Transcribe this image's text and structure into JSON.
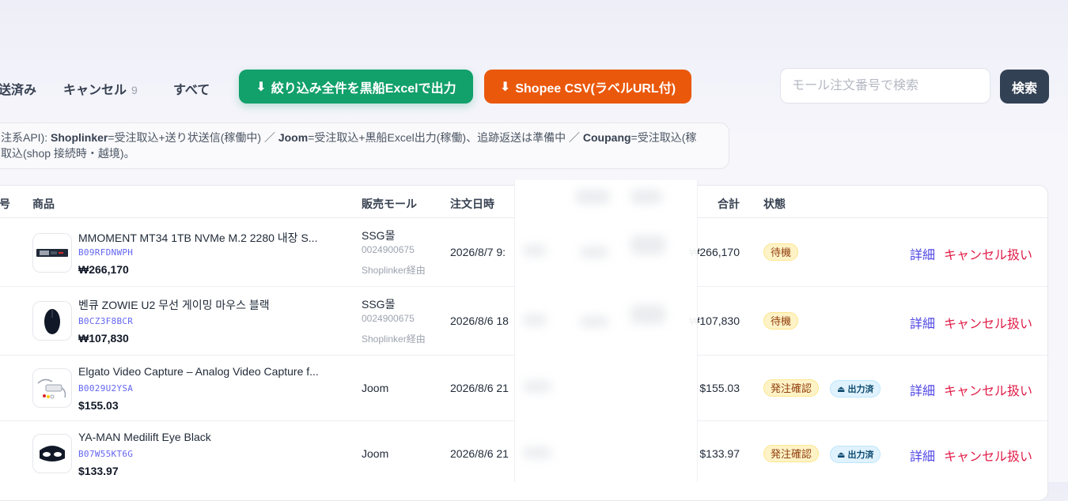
{
  "tabs": [
    {
      "label": "送済み",
      "count": ""
    },
    {
      "label": "キャンセル",
      "count": "9"
    },
    {
      "label": "すべて",
      "count": ""
    }
  ],
  "toolbar": {
    "excel_label": "絞り込み全件を黒船Excelで出力",
    "shopee_label": "Shopee CSV(ラベルURL付)",
    "download_glyph": "⬇",
    "search_placeholder": "モール注文番号で検索",
    "search_button": "検索"
  },
  "info": {
    "prefix": "注系API): ",
    "shoplinker": "Shoplinker",
    "shoplinker_desc": "=受注取込+送り状送信(稼働中) ／ ",
    "joom": "Joom",
    "joom_desc": "=受注取込+黒船Excel出力(稼働)、追跡返送は準備中 ／ ",
    "coupang": "Coupang",
    "coupang_desc": "=受注取込(稼",
    "line2": "取込(shop 接続時・越境)。"
  },
  "table": {
    "headers": {
      "no": "号",
      "product": "商品",
      "mall": "販売モール",
      "date": "注文日時",
      "total": "合計",
      "status": "状態"
    },
    "rows": [
      {
        "name": "MMOMENT MT34 1TB NVMe M.2 2280 내장 S...",
        "asin": "B09RFDNWPH",
        "price": "₩266,170",
        "mall": "SSG몰",
        "mall_id": "0024900675",
        "via": "Shoplinker経由",
        "date": "2026/8/7 9:",
        "total": "₩266,170",
        "status": "待機",
        "output": "",
        "detail": "詳細",
        "cancel": "キャンセル扱い"
      },
      {
        "name": "벤큐 ZOWIE U2 무선 게이밍 마우스 블랙",
        "asin": "B0CZ3F8BCR",
        "price": "₩107,830",
        "mall": "SSG몰",
        "mall_id": "0024900675",
        "via": "Shoplinker経由",
        "date": "2026/8/6 18",
        "total": "₩107,830",
        "status": "待機",
        "output": "",
        "detail": "詳細",
        "cancel": "キャンセル扱い"
      },
      {
        "name": "Elgato Video Capture – Analog Video Capture f...",
        "asin": "B0029U2YSA",
        "price": "$155.03",
        "mall": "Joom",
        "mall_id": "",
        "via": "",
        "date": "2026/8/6 21",
        "total": "$155.03",
        "status": "発注確認",
        "output": "出力済",
        "detail": "詳細",
        "cancel": "キャンセル扱い"
      },
      {
        "name": "YA-MAN Medilift Eye Black",
        "asin": "B07W55KT6G",
        "price": "$133.97",
        "mall": "Joom",
        "mall_id": "",
        "via": "",
        "date": "2026/8/6 21",
        "total": "$133.97",
        "status": "発注確認",
        "output": "出力済",
        "detail": "詳細",
        "cancel": "キャンセル扱い"
      }
    ]
  },
  "colors": {
    "green": "#12a06b",
    "orange": "#ea580c",
    "dark": "#334155",
    "link": "#4f46e5",
    "danger": "#e11d48"
  }
}
